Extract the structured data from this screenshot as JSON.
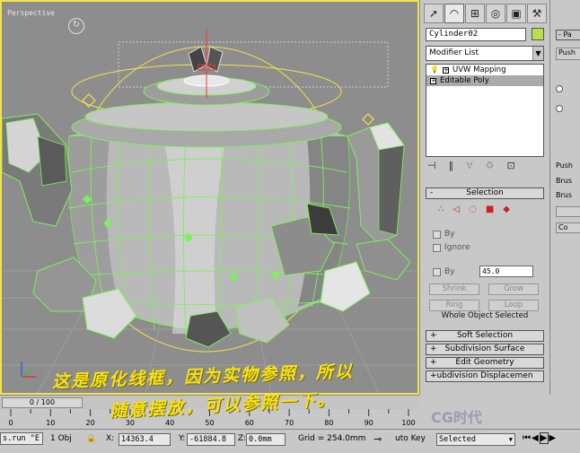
{
  "viewport": {
    "label": "Perspective",
    "annotation_line1": "这是原化线框，因为实物参照，所以",
    "annotation_line2": "随意摆放，可以参照一下。",
    "accent_color": "#f3e34a",
    "wire_color": "#7df05a"
  },
  "command_panel": {
    "object_name": "Cylinder02",
    "object_color": "#b8e04a",
    "modifier_list": "Modifier List",
    "stack": [
      {
        "label": "UVW Mapping",
        "selected": false
      },
      {
        "label": "Editable Poly",
        "selected": true
      }
    ],
    "selection_rollout": {
      "title": "Selection",
      "by_vertex": "By",
      "ignore_backfacing": "Ignore",
      "by_angle": "By",
      "angle_value": "45.0",
      "shrink": "Shrink",
      "grow": "Grow",
      "ring": "Ring",
      "loop": "Loop",
      "status": "Whole Object Selected"
    },
    "rollouts": [
      "Soft Selection",
      "Subdivision Surface",
      "Edit Geometry",
      "Subdivision Displacement"
    ],
    "rollout_label_3": "ubdivision Displacemen"
  },
  "far_panel": {
    "title": "Pa",
    "push": "Push",
    "brush1": "Brus",
    "brush2": "Brus",
    "push2": "Push",
    "co": "Co"
  },
  "timeline": {
    "frame": "0 / 100"
  },
  "ruler": {
    "ticks": [
      "0",
      "10",
      "20",
      "30",
      "40",
      "50",
      "60",
      "70",
      "80",
      "90",
      "100"
    ]
  },
  "statusbar": {
    "script": "s.run \"E",
    "objects": "1 Obj",
    "x_label": "X:",
    "x_value": "14363.4",
    "y_label": "Y:",
    "y_value": "-61884.8",
    "z_label": "Z:",
    "z_value": "0.0mm",
    "grid": "Grid = 254.0mm",
    "autokey": "uto Key",
    "selected": "Selected"
  },
  "watermark": "CG时代"
}
